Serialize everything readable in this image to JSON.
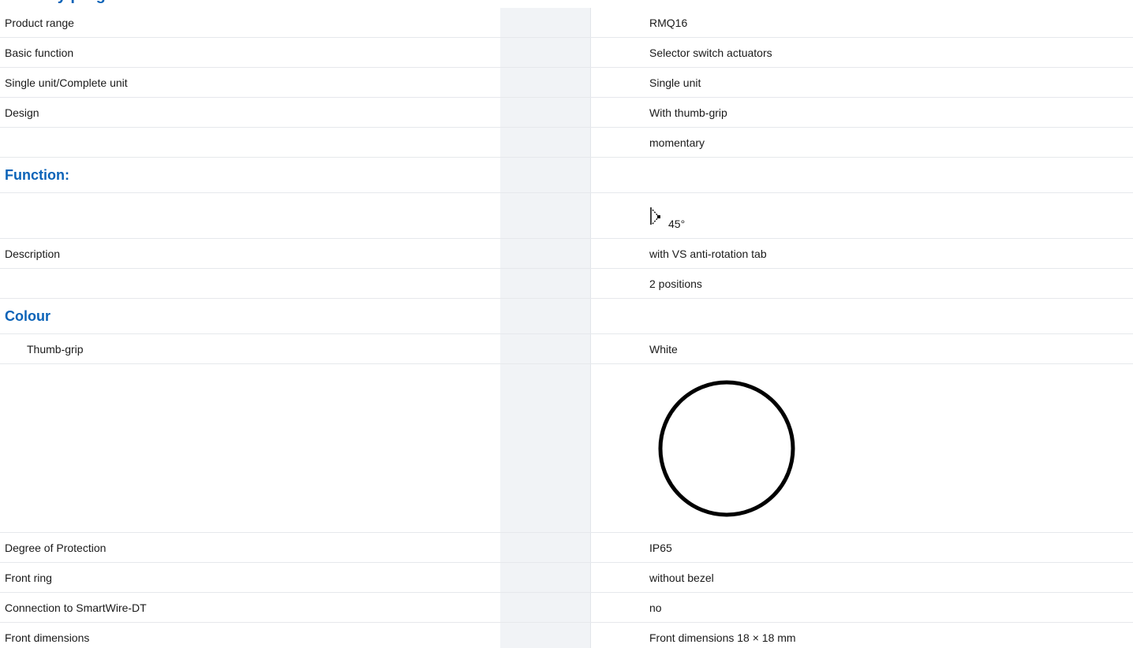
{
  "section": {
    "title": "Delivery program"
  },
  "rows": {
    "product_range": {
      "label": "Product range",
      "value": "RMQ16"
    },
    "basic_function": {
      "label": "Basic function",
      "value": "Selector switch actuators"
    },
    "single_complete": {
      "label": "Single unit/Complete unit",
      "value": "Single unit"
    },
    "design": {
      "label": "Design",
      "value": "With thumb-grip"
    },
    "design_2": {
      "label": "",
      "value": "momentary"
    },
    "function_group": {
      "label": "Function:"
    },
    "function_symbol": {
      "angle": "45°",
      "icon": "selector-switch-45-symbol-icon"
    },
    "description": {
      "label": "Description",
      "value": "with VS anti-rotation tab"
    },
    "description_2": {
      "label": "",
      "value": "2 positions"
    },
    "colour_group": {
      "label": "Colour"
    },
    "thumb_grip": {
      "label": "Thumb-grip",
      "value": "White",
      "swatch_icon": "white-colour-swatch-icon"
    },
    "degree_protection": {
      "label": "Degree of Protection",
      "value": "IP65"
    },
    "front_ring": {
      "label": "Front ring",
      "value": "without bezel"
    },
    "smartwire": {
      "label": "Connection to SmartWire-DT",
      "value": "no"
    },
    "front_dimensions": {
      "label": "Front dimensions",
      "value": "Front dimensions 18 × 18 mm"
    }
  },
  "colors": {
    "accent": "#0b63b8",
    "shade_column": "#f1f3f6",
    "row_divider": "#e6e8ec"
  }
}
